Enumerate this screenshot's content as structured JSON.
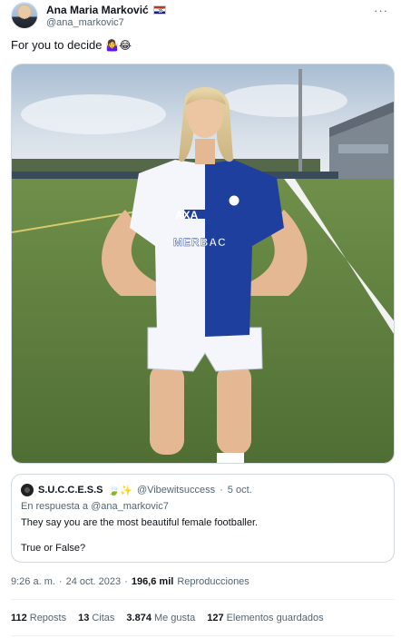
{
  "author": {
    "name": "Ana Maria Marković",
    "handle": "@ana_markovic7",
    "flag_icon": "croatia-flag-icon"
  },
  "menu_icon": "more-options-icon",
  "tweet": {
    "text": "For you to decide",
    "emojis": "🤷‍♀️😂"
  },
  "quoted": {
    "name": "S.U.C.C.E.S.S",
    "name_emojis": "🍃✨",
    "handle": "@Vibewitsuccess",
    "separator": "·",
    "date": "5 oct.",
    "reply_prefix": "En respuesta a",
    "reply_handle": "@ana_markovic7",
    "line1": "They say you are the most beautiful female footballer.",
    "line2": "True or False?"
  },
  "meta": {
    "time": "9:26 a. m.",
    "sep1": "·",
    "date": "24 oct. 2023",
    "sep2": "·",
    "views_count": "196,6 mil",
    "views_label": "Reproducciones"
  },
  "stats": [
    {
      "count": "112",
      "label": "Reposts"
    },
    {
      "count": "13",
      "label": "Citas"
    },
    {
      "count": "3.874",
      "label": "Me gusta"
    },
    {
      "count": "127",
      "label": "Elementos guardados"
    }
  ],
  "photo": {
    "jersey_text": "MERBAC",
    "sponsor_text": "AXA"
  },
  "colors": {
    "text_primary": "#0f1419",
    "text_secondary": "#536471",
    "border": "#cfd9de",
    "jersey_blue": "#1f3f9e"
  }
}
